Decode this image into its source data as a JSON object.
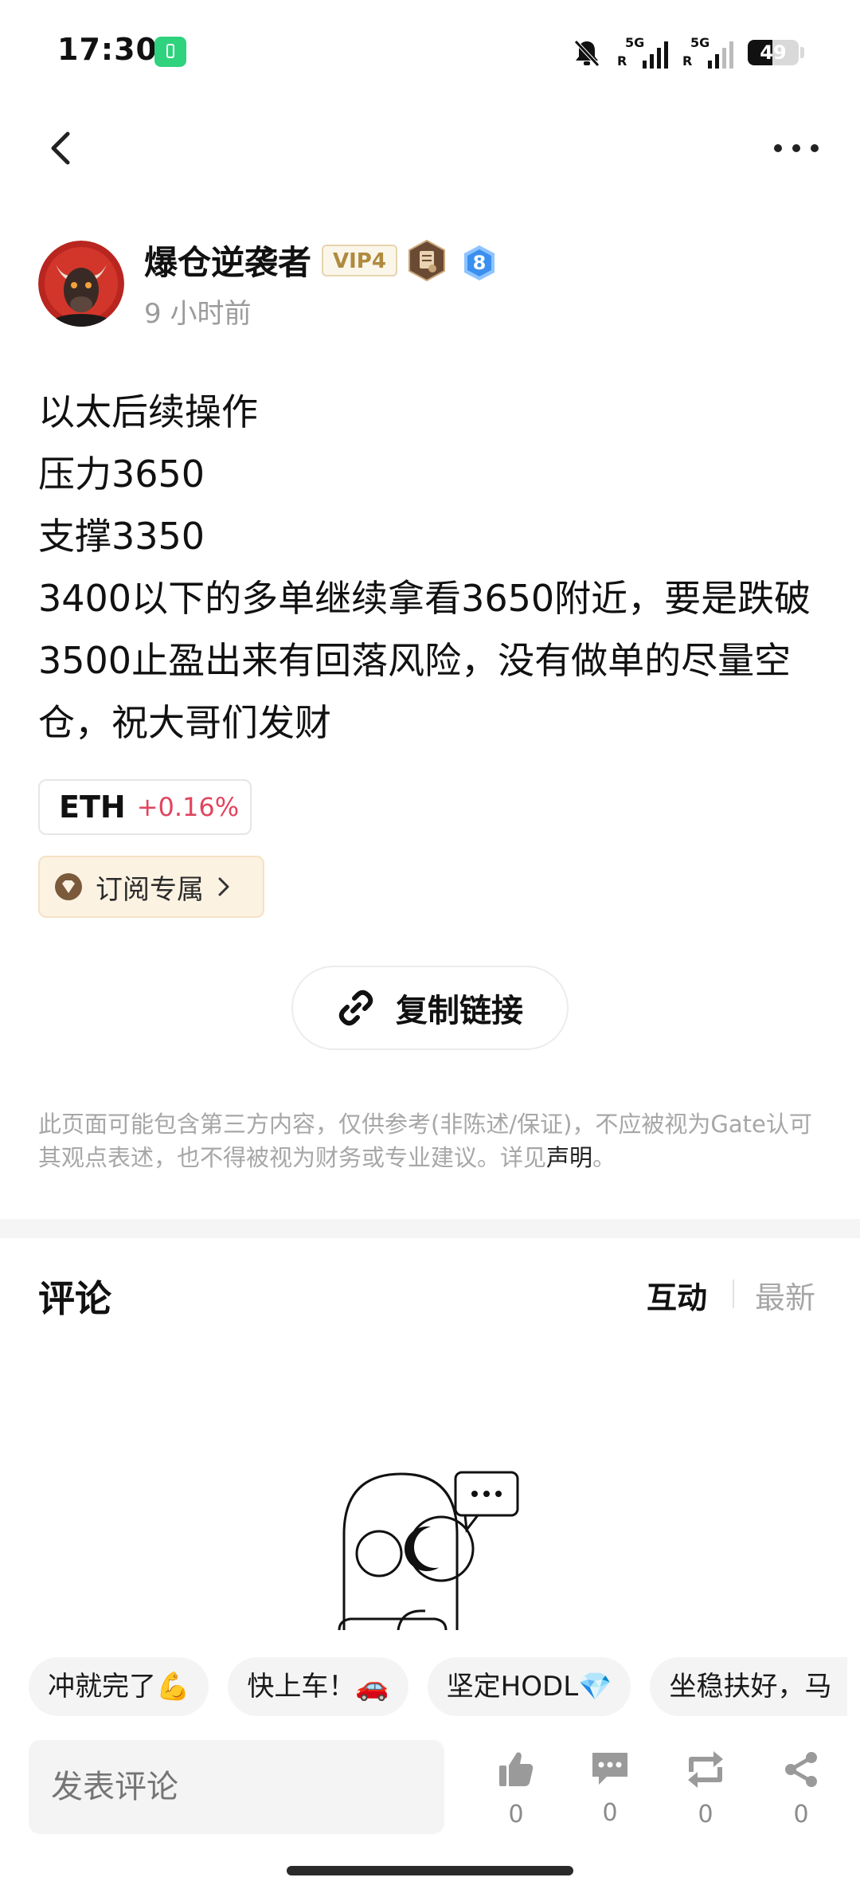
{
  "status_bar": {
    "time": "17:30",
    "sim1_tag": "5G",
    "sim1_r": "R",
    "sim2_tag": "5G",
    "sim2_r": "R",
    "battery": "49",
    "battery_level": 0.49,
    "icons": [
      "battery-saver-icon",
      "bell-muted-icon",
      "signal-icon",
      "signal-icon",
      "battery-icon"
    ]
  },
  "nav": {
    "icons": [
      "back-arrow-icon",
      "more-options-icon"
    ]
  },
  "author": {
    "name": "爆仓逆袭者",
    "vip": "VIP4",
    "level": "8",
    "posted": "9 小时前"
  },
  "post": {
    "lines": [
      "以太后续操作",
      "压力3650",
      "支撑3350",
      "3400以下的多单继续拿看3650附近，要是跌破3500止盈出来有回落风险，没有做单的尽量空仓，祝大哥们发财"
    ],
    "coin": {
      "symbol": "ETH",
      "change": "+0.16%"
    },
    "subscribe_label": "订阅专属",
    "copy_link_label": "复制链接"
  },
  "disclaimer": {
    "text": "此页面可能包含第三方内容，仅供参考(非陈述/保证)，不应被视为Gate认可其观点表述，也不得被视为财务或专业建议。详见",
    "link": "声明",
    "end": "。"
  },
  "comments": {
    "title": "评论",
    "tab_interact": "互动",
    "tab_latest": "最新"
  },
  "quick_replies": [
    "冲就完了💪",
    "快上车！🚗",
    "坚定HODL💎",
    "坐稳扶好，马"
  ],
  "bottom_bar": {
    "input_placeholder": "发表评论",
    "like_count": "0",
    "comment_count": "0",
    "repost_count": "0",
    "share_count": "0"
  },
  "colors": {
    "negative_red": "#e0455f",
    "vip_gold": "#b08a3e",
    "level_blue": "#3a8ff0"
  }
}
